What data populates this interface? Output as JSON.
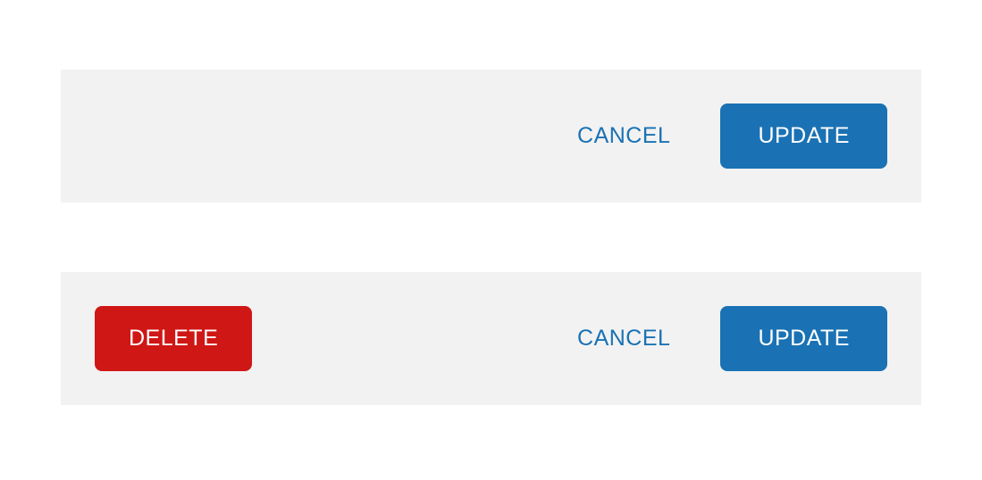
{
  "panel1": {
    "cancel_label": "CANCEL",
    "update_label": "UPDATE"
  },
  "panel2": {
    "delete_label": "DELETE",
    "cancel_label": "CANCEL",
    "update_label": "UPDATE"
  }
}
